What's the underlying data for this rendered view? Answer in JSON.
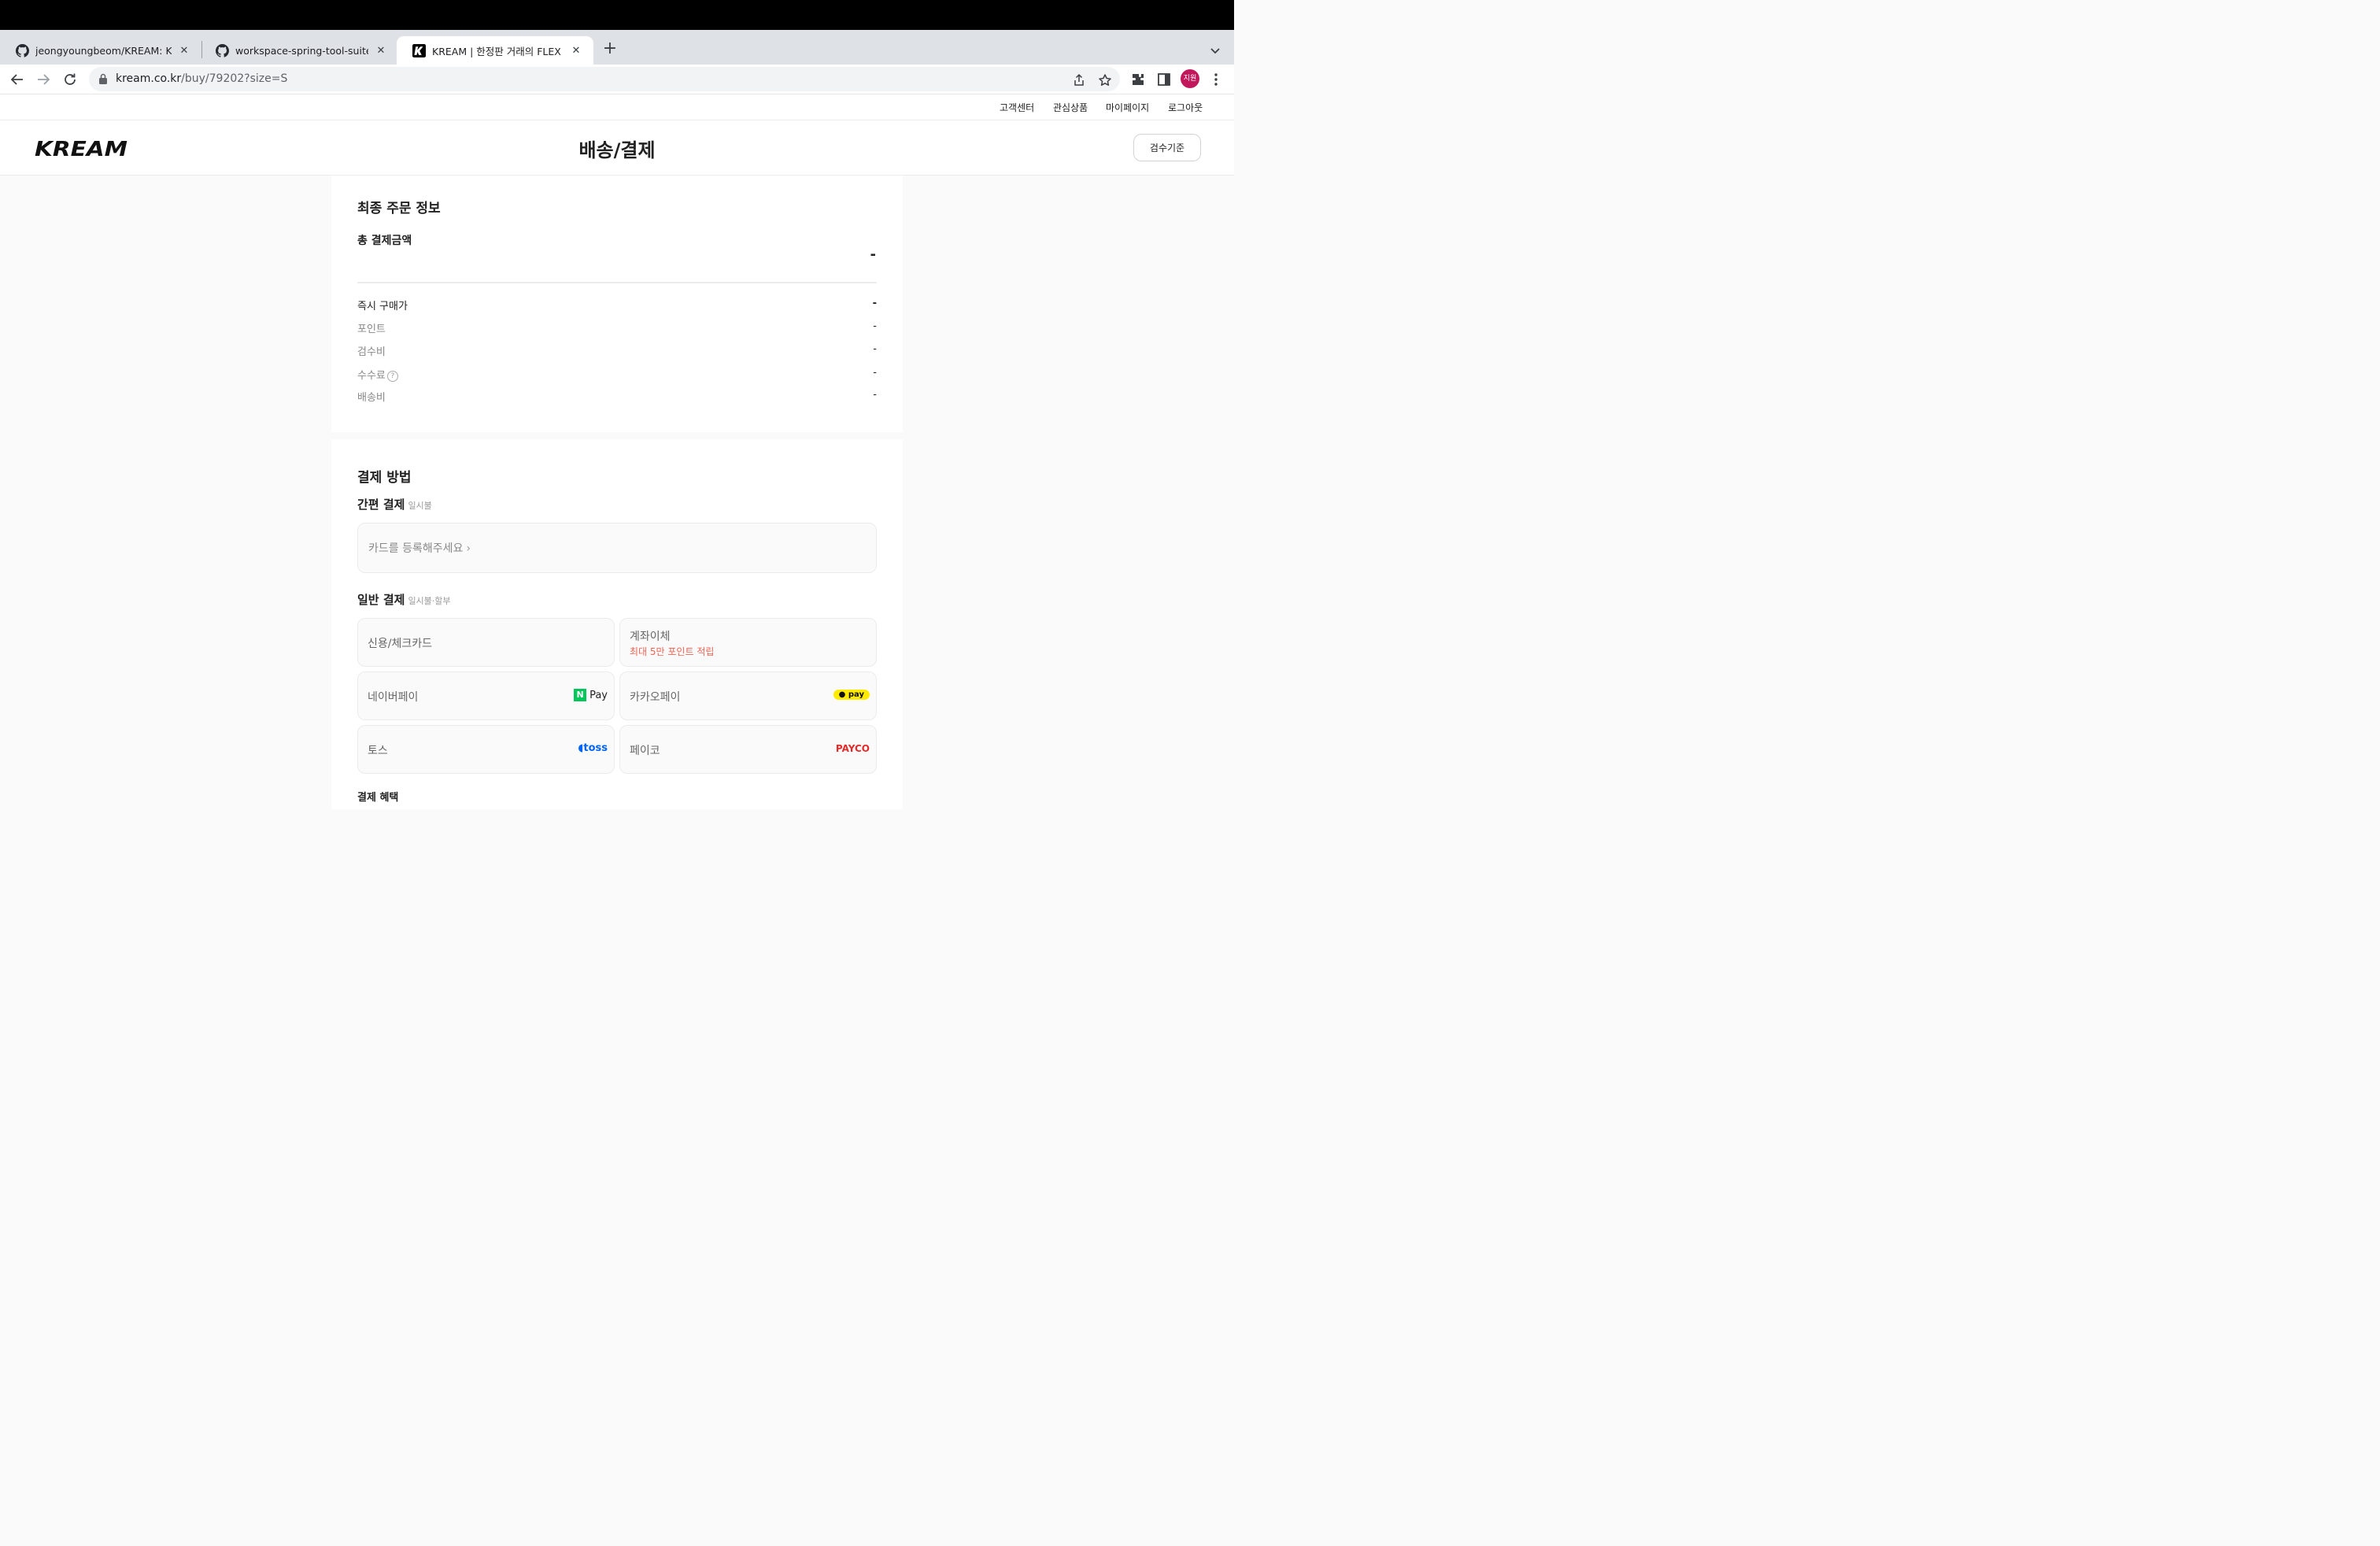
{
  "browser": {
    "tabs": [
      {
        "title": "jeongyoungbeom/KREAM: KREAM",
        "icon": "github-icon"
      },
      {
        "title": "workspace-spring-tool-suite-4",
        "icon": "github-icon"
      },
      {
        "title": "KREAM | 한정판 거래의 FLEX",
        "icon": "kream-icon"
      }
    ],
    "url_host": "kream.co.kr",
    "url_path": "/buy/79202?size=S",
    "profile_initials": "지원"
  },
  "site": {
    "util_links": [
      "고객센터",
      "관심상품",
      "마이페이지",
      "로그아웃"
    ],
    "logo_text": "KREAM",
    "page_title": "배송/결제",
    "inspect_button": "검수기준"
  },
  "order_summary": {
    "title": "최종 주문 정보",
    "total_label": "총 결제금액",
    "total_value": "-",
    "rows": [
      {
        "label": "즉시 구매가",
        "value": "-"
      },
      {
        "label": "포인트",
        "value": "-"
      },
      {
        "label": "검수비",
        "value": "-"
      },
      {
        "label": "수수료",
        "value": "-"
      },
      {
        "label": "배송비",
        "value": "-"
      }
    ],
    "help_symbol": "?"
  },
  "payment": {
    "title": "결제 방법",
    "easy_label": "간편 결제",
    "easy_note": "일시불",
    "card_register": "카드를 등록해주세요",
    "general_label": "일반 결제",
    "general_note": "일시불·할부",
    "methods": [
      {
        "name": "신용/체크카드"
      },
      {
        "name": "계좌이체",
        "promo": "최대 5만 포인트 적립"
      },
      {
        "name": "네이버페이",
        "logo": "Pay",
        "badge": "N"
      },
      {
        "name": "카카오페이",
        "logo": "pay"
      },
      {
        "name": "토스",
        "logo": "toss"
      },
      {
        "name": "페이코",
        "logo": "PAYCO"
      }
    ],
    "benefits_label": "결제 혜택"
  },
  "colors": {
    "accent_red": "#ef6253",
    "naver_green": "#03c75a",
    "kakao_yellow": "#ffeb00",
    "toss_blue": "#0064ff",
    "payco_red": "#e42b2b",
    "profile": "#c2185b"
  }
}
